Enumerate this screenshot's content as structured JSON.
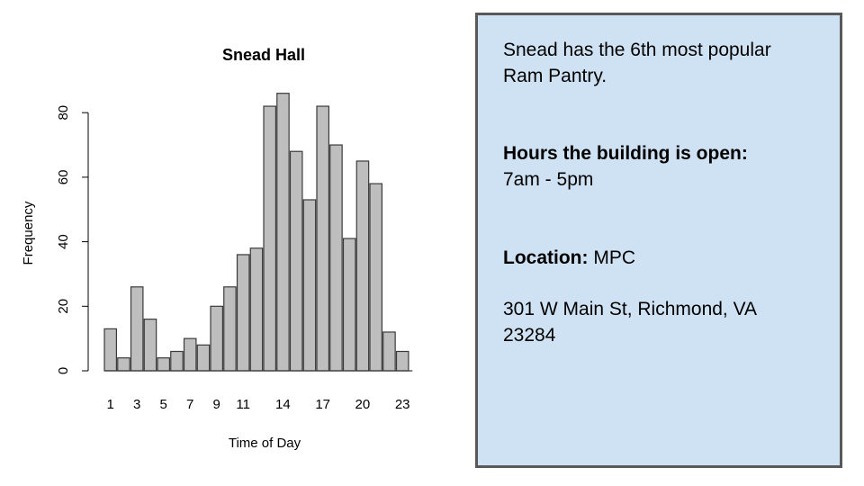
{
  "chart_data": {
    "type": "bar",
    "title": "Snead Hall",
    "xlabel": "Time of Day",
    "ylabel": "Frequency",
    "categories": [
      "1",
      "2",
      "3",
      "4",
      "5",
      "6",
      "7",
      "8",
      "9",
      "10",
      "11",
      "12",
      "13",
      "14",
      "15",
      "16",
      "17",
      "18",
      "19",
      "20",
      "21",
      "22",
      "23"
    ],
    "x_tick_labels": [
      "1",
      "3",
      "5",
      "7",
      "9",
      "11",
      "14",
      "17",
      "20",
      "23"
    ],
    "y_ticks": [
      "0",
      "20",
      "40",
      "60",
      "80"
    ],
    "values": [
      13,
      4,
      26,
      16,
      4,
      6,
      10,
      8,
      20,
      26,
      36,
      38,
      82,
      86,
      68,
      53,
      82,
      70,
      41,
      65,
      58,
      12,
      6
    ],
    "ylim": [
      0,
      80
    ],
    "bar_color": "#bebebe",
    "grid": false
  },
  "info": {
    "intro": "Snead has the 6th most popular Ram Pantry.",
    "hours_label": "Hours the building is open:",
    "hours_value": "7am - 5pm",
    "location_label": "Location:",
    "location_value": "MPC",
    "address_line1": "301 W Main St, Richmond, VA",
    "address_line2": "23284"
  },
  "colors": {
    "panel_background": "#cfe2f3",
    "panel_border": "#595959"
  }
}
